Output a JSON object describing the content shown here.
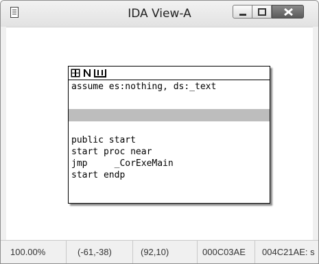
{
  "window": {
    "title": "IDA View-A",
    "icons": {
      "system": "document-icon",
      "minimize": "minimize-icon",
      "maximize": "maximize-icon",
      "close": "close-icon"
    }
  },
  "node": {
    "header_icons": [
      "color-palette-icon",
      "rename-n-icon",
      "group-icon"
    ],
    "lines": [
      "assume es:nothing, ds:_text",
      "public start",
      "start proc near",
      "jmp     _CorExeMain",
      "start endp"
    ]
  },
  "status": {
    "zoom": "100.00%",
    "mouse_pos": "(-61,-38)",
    "graph_pos": "(92,10)",
    "offset": "000C03AE",
    "address": "004C21AE: s"
  },
  "colors": {
    "highlight_band": "#bdbdbd",
    "close_button": "#6a6a6a"
  }
}
